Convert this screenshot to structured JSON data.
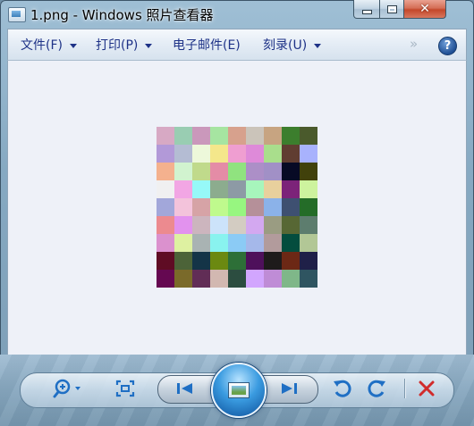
{
  "window": {
    "title": "1.png - Windows 照片查看器",
    "app_icon": "photo-viewer-icon",
    "caption_buttons": {
      "minimize": "─",
      "maximize": "□",
      "close": "✕"
    }
  },
  "menu": {
    "file": "文件(F)",
    "print": "打印(P)",
    "email": "电子邮件(E)",
    "burn": "刻录(U)",
    "more": "»",
    "help": "?"
  },
  "image_colors": [
    "#d7a9c4",
    "#99cdb2",
    "#ca98bb",
    "#a6e5a1",
    "#d7a18d",
    "#cbc4ba",
    "#c7a481",
    "#3c7e2d",
    "#4a5a2c",
    "#b299d8",
    "#b4bcd3",
    "#edf8da",
    "#f4e78b",
    "#ef9ed1",
    "#de8ad9",
    "#a9de8c",
    "#603d31",
    "#a8b2fd",
    "#f4b18e",
    "#d1f3cf",
    "#c0da8b",
    "#e48ca6",
    "#90e37f",
    "#ac8fc7",
    "#a190c6",
    "#070a25",
    "#41410b",
    "#f0f0f1",
    "#f2a6e4",
    "#96f9f8",
    "#8cac8e",
    "#8d9aa5",
    "#a7f5bc",
    "#e8d09d",
    "#7c2379",
    "#cdf39e",
    "#a2a7da",
    "#f3c3db",
    "#d6a3a6",
    "#bffa8d",
    "#97f680",
    "#b59099",
    "#8bb2e9",
    "#3e5071",
    "#246c28",
    "#ec8a8f",
    "#e292ee",
    "#ccb5be",
    "#cce3fa",
    "#d3ccc2",
    "#d3a8f0",
    "#9a9c82",
    "#576734",
    "#5d7d6e",
    "#db91ce",
    "#def1a1",
    "#a9b3b3",
    "#89f3ef",
    "#8bcbf5",
    "#a5b8ea",
    "#b29b9c",
    "#044d3e",
    "#b2c796",
    "#5f0c24",
    "#4c6338",
    "#143447",
    "#6b8911",
    "#2d6f37",
    "#4e105b",
    "#1e1b1b",
    "#6c2815",
    "#1f2048",
    "#650851",
    "#7a6a2a",
    "#612d56",
    "#d2b8b1",
    "#2c4d40",
    "#d2a6fe",
    "#bf8cd6",
    "#7fb789",
    "#2f5561"
  ],
  "controls": {
    "zoom": "zoom-icon",
    "actual_size": "fit-window-icon",
    "previous": "previous-icon",
    "slideshow": "slideshow-icon",
    "next": "next-icon",
    "rotate_ccw": "rotate-counterclockwise-icon",
    "rotate_cw": "rotate-clockwise-icon",
    "delete": "delete-icon"
  },
  "colors": {
    "menu_text": "#1e3287",
    "viewer_bg": "#eef1f8",
    "accent_blue": "#1f6fc4",
    "delete_red": "#d12b2b"
  }
}
